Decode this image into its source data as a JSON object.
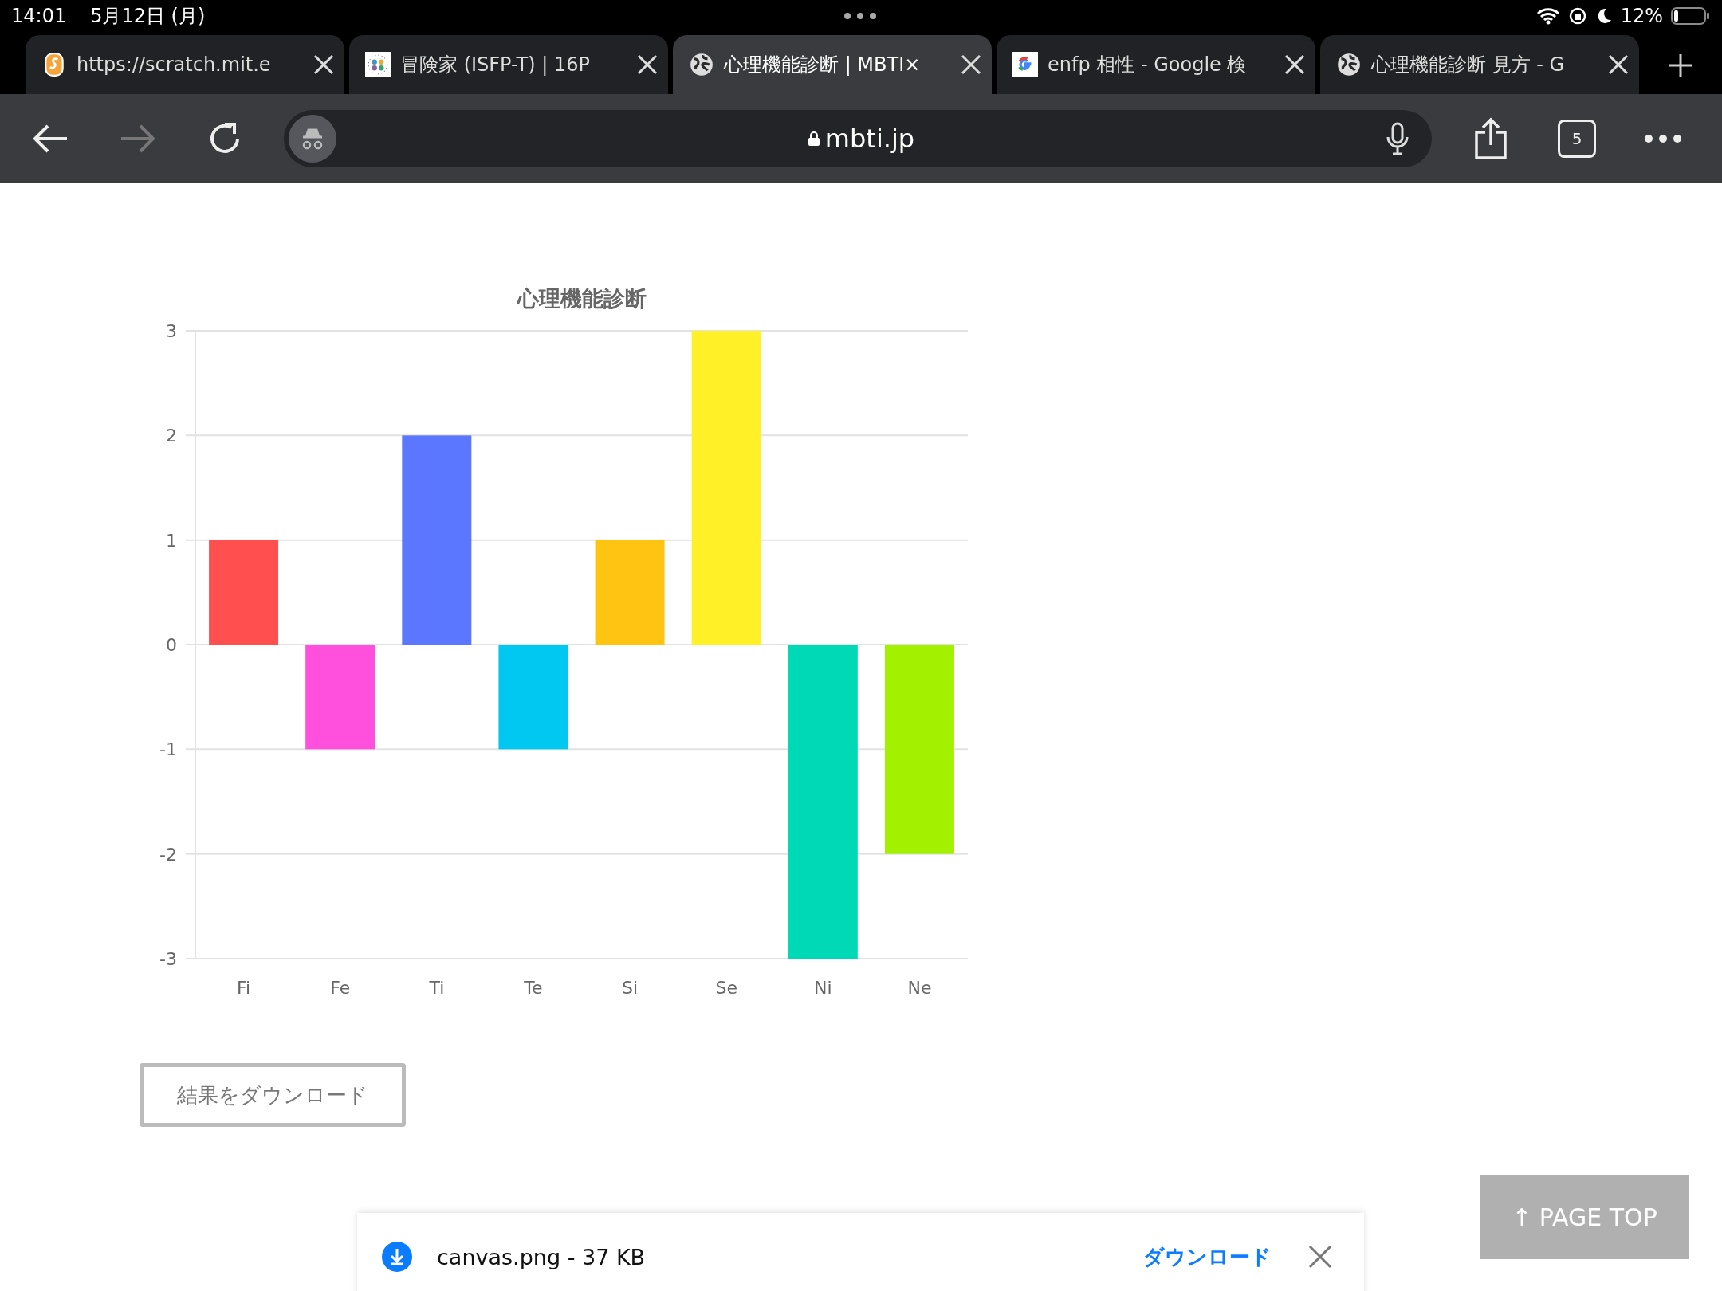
{
  "status_bar": {
    "time": "14:01",
    "date": "5月12日 (月)",
    "battery": "12%"
  },
  "tabs": [
    {
      "title": "https://scratch.mit.e",
      "kind": "scratch",
      "selected": false
    },
    {
      "title": "冒険家 (ISFP-T) | 16P",
      "kind": "dots",
      "selected": false
    },
    {
      "title": "心理機能診断 | MBTI×",
      "kind": "globe",
      "selected": true
    },
    {
      "title": "enfp 相性 - Google 検",
      "kind": "google",
      "selected": false
    },
    {
      "title": "心理機能診断 見方 - G",
      "kind": "globe",
      "selected": false
    }
  ],
  "toolbar": {
    "forward_disabled": true,
    "url": "mbti.jp",
    "tab_count": "5"
  },
  "chart": {
    "chart_data": {
      "type": "bar",
      "title": "心理機能診断",
      "categories": [
        "Fi",
        "Fe",
        "Ti",
        "Te",
        "Si",
        "Se",
        "Ni",
        "Ne"
      ],
      "values": [
        1,
        -1,
        2,
        -1,
        1,
        3,
        -3,
        -2
      ],
      "colors": [
        "#ff4f4f",
        "#ff4fdc",
        "#5b76ff",
        "#00c8f0",
        "#ffc311",
        "#fff027",
        "#00d9b5",
        "#a3f000"
      ],
      "grid": true,
      "ylim": [
        -3,
        3
      ],
      "yticks": [
        3,
        2,
        1,
        0,
        -1,
        -2,
        -3
      ]
    }
  },
  "download_result_button": "結果をダウンロード",
  "download_bar": {
    "file": "canvas.png - 37 KB",
    "action": "ダウンロード"
  },
  "page_top_button": "↑ PAGE TOP"
}
